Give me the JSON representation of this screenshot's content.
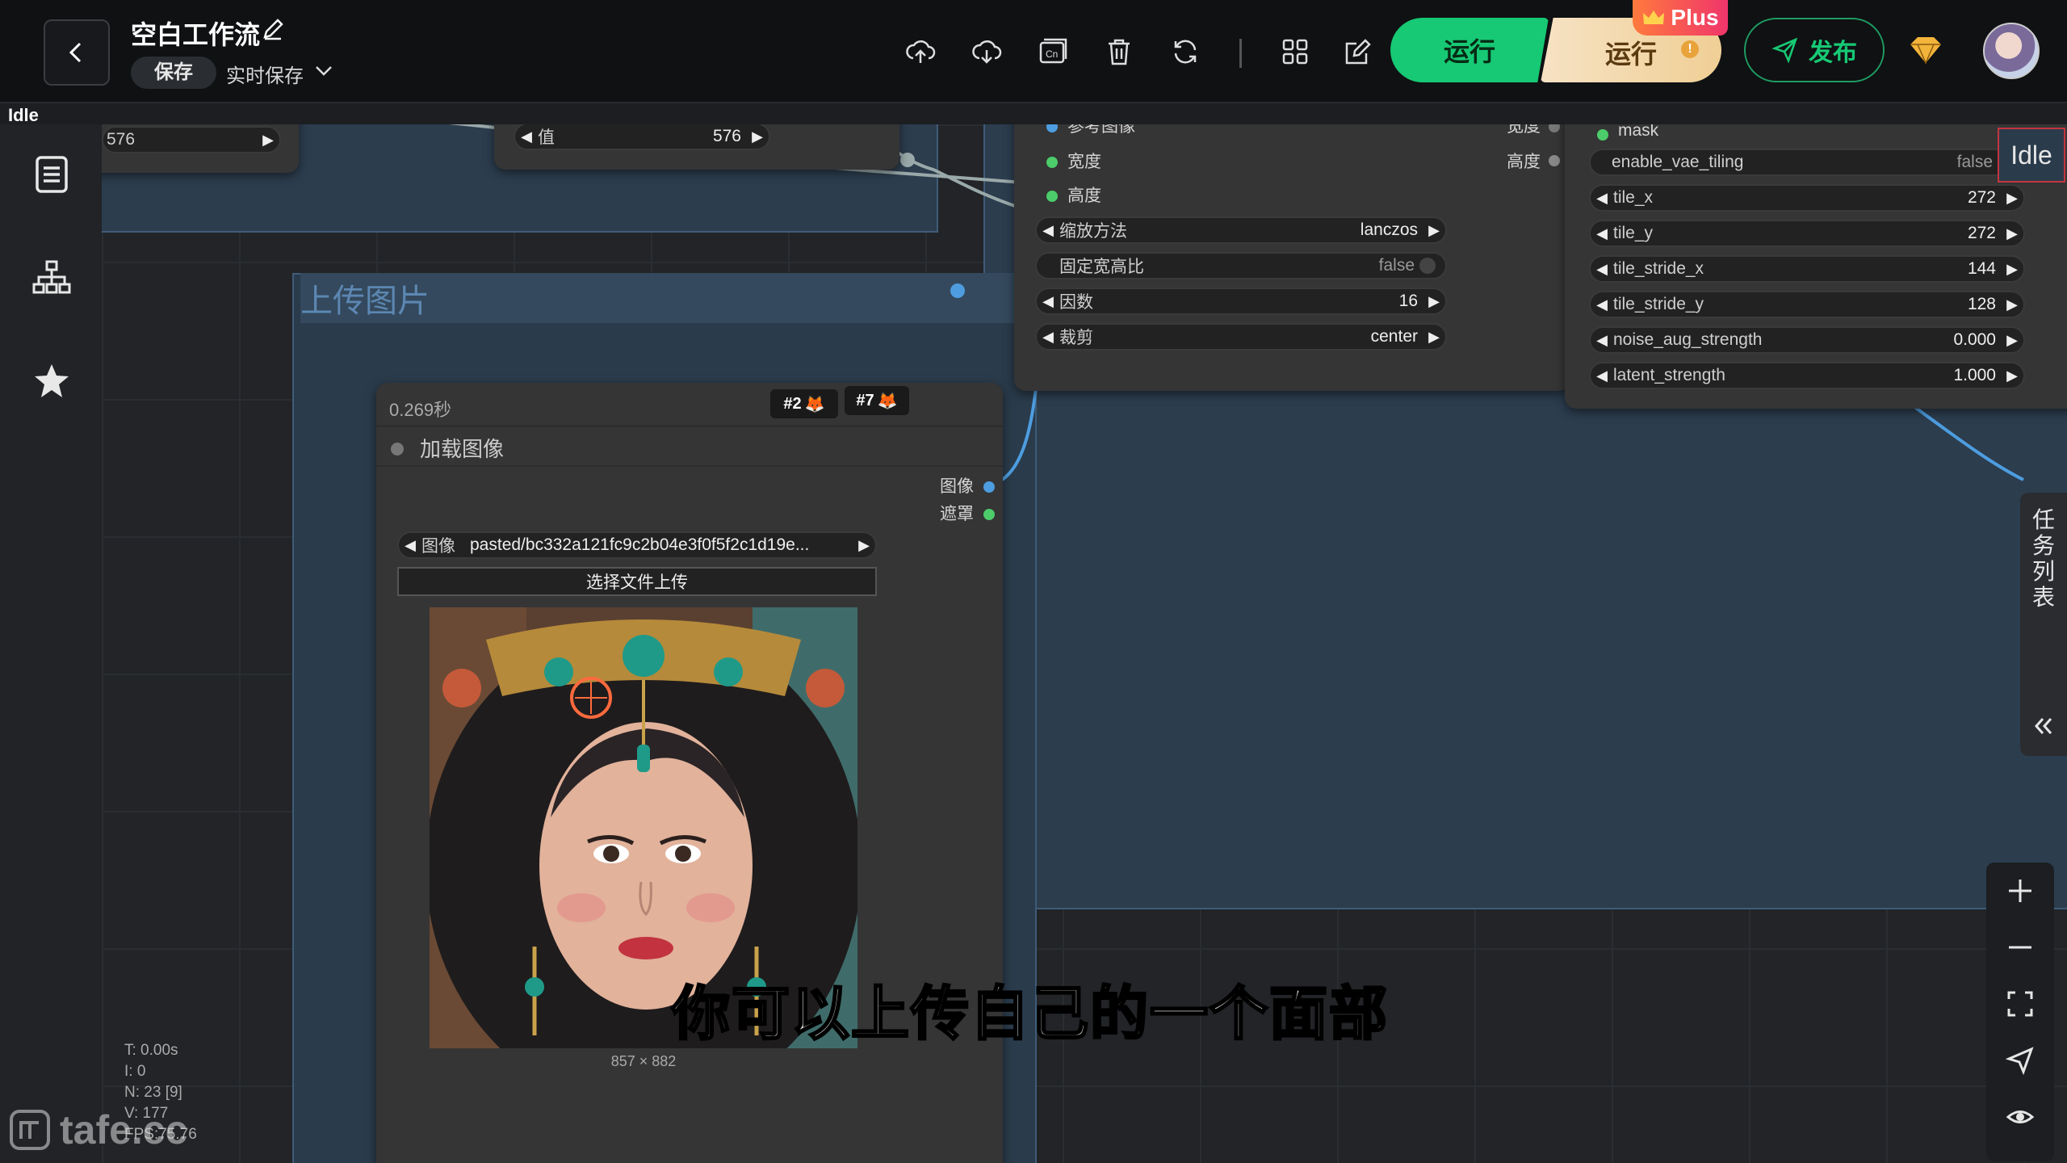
{
  "header": {
    "title": "空白工作流",
    "save_label": "保存",
    "autosave_label": "实时保存",
    "run_label": "运行",
    "run_plus_label": "运行",
    "plus_badge": "Plus",
    "publish_label": "发布",
    "status_corner": "Idle",
    "toolbar_icons": [
      "upload-icon",
      "download-icon",
      "gallery-icon",
      "trash-icon",
      "refresh-icon",
      "grid-icon",
      "edit-icon"
    ]
  },
  "sidebar": {
    "icons": [
      "list-icon",
      "network-icon",
      "star-icon"
    ]
  },
  "canvas": {
    "top_left_node": {
      "value": "576"
    },
    "value_node": {
      "label": "值",
      "value": "576"
    },
    "resize_node": {
      "inputs": [
        "参考图像",
        "宽度",
        "高度"
      ],
      "right_labels": [
        "宽度",
        "高度"
      ],
      "widgets": [
        {
          "label": "缩放方法",
          "value": "lanczos",
          "type": "combo"
        },
        {
          "label": "固定宽高比",
          "value": "false",
          "type": "toggle"
        },
        {
          "label": "因数",
          "value": "16",
          "type": "number"
        },
        {
          "label": "裁剪",
          "value": "center",
          "type": "combo"
        }
      ]
    },
    "upscale_node": {
      "input_label": "mask",
      "widgets": [
        {
          "label": "enable_vae_tiling",
          "value": "false",
          "type": "toggle"
        },
        {
          "label": "tile_x",
          "value": "272",
          "type": "number"
        },
        {
          "label": "tile_y",
          "value": "272",
          "type": "number"
        },
        {
          "label": "tile_stride_x",
          "value": "144",
          "type": "number"
        },
        {
          "label": "tile_stride_y",
          "value": "128",
          "type": "number"
        },
        {
          "label": "noise_aug_strength",
          "value": "0.000",
          "type": "number"
        },
        {
          "label": "latent_strength",
          "value": "1.000",
          "type": "number"
        }
      ]
    },
    "idle_badge": "Idle",
    "upload_group": {
      "title": "上传图片",
      "timing": "0.269秒",
      "badges": [
        "#2",
        "#7"
      ],
      "node_title": "加载图像",
      "outputs": [
        "图像",
        "遮罩"
      ],
      "image_label": "图像",
      "image_value": "pasted/bc332a121fc9c2b04e3f0f5f2c1d19e...",
      "upload_button": "选择文件上传",
      "image_size": "857 × 882"
    },
    "task_list_label": "任务列表",
    "zoom_controls": [
      "zoom-in-icon",
      "zoom-out-icon",
      "fit-view-icon",
      "locate-icon",
      "eye-icon"
    ]
  },
  "stats": {
    "t": "T: 0.00s",
    "i": "I: 0",
    "n": "N: 23 [9]",
    "v": "V: 177",
    "fps": "FPS:75.76"
  },
  "watermark": "tafe.cc",
  "subtitle": "你可以上传自己的一个面部",
  "colors": {
    "accent": "#17c974",
    "group_bg": "#2c3d4e",
    "link_blue": "#4d9de0",
    "port_green": "#4ccc6a"
  }
}
